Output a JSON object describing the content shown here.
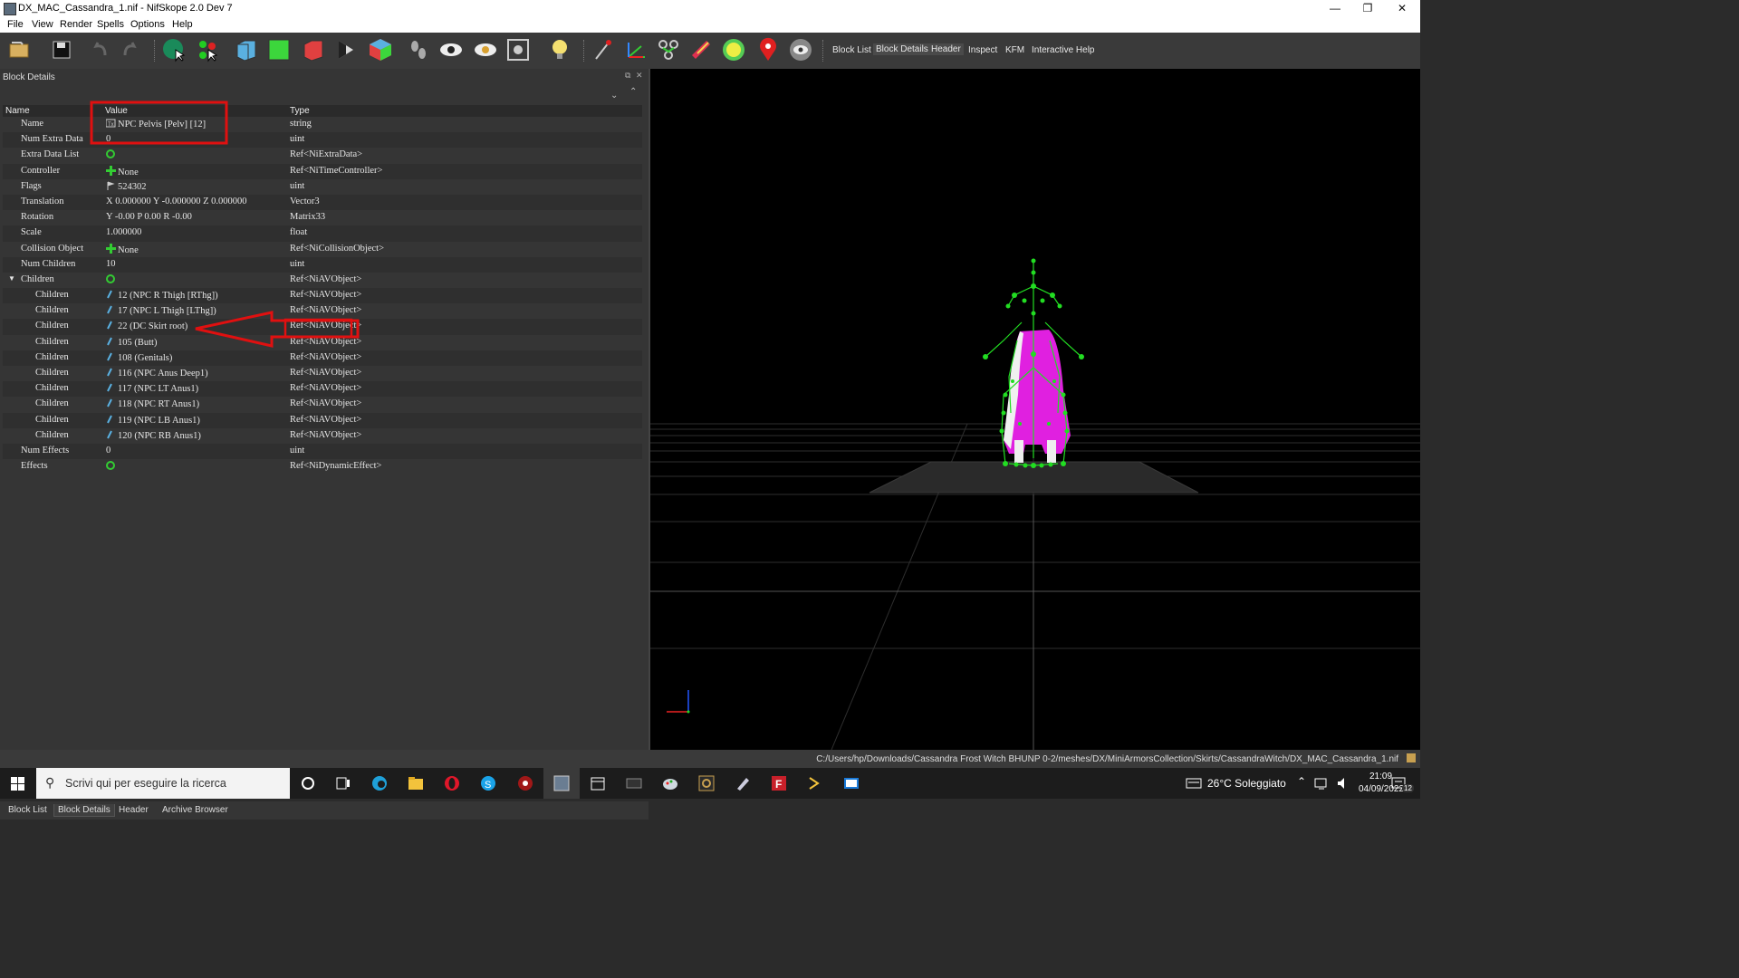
{
  "window": {
    "title": "DX_MAC_Cassandra_1.nif - NifSkope 2.0 Dev 7"
  },
  "menu": [
    "File",
    "View",
    "Render",
    "Spells",
    "Options",
    "Help"
  ],
  "toolbar_tabs": [
    "Block List",
    "Block Details",
    "Header",
    "Inspect",
    "KFM",
    "Interactive Help"
  ],
  "dock": {
    "title": "Block Details"
  },
  "table": {
    "headers": {
      "name": "Name",
      "value": "Value",
      "type": "Type"
    },
    "rows": [
      {
        "name": "Name",
        "value": "NPC Pelvis [Pelv] [12]",
        "type": "string",
        "icon": "text-icon"
      },
      {
        "name": "Num Extra Data",
        "value": "0",
        "type": "uint"
      },
      {
        "name": "Extra Data List",
        "value": "",
        "type": "Ref<NiExtraData>",
        "icon": "array-icon"
      },
      {
        "name": "Controller",
        "value": "None",
        "type": "Ref<NiTimeController>",
        "icon": "plus-icon"
      },
      {
        "name": "Flags",
        "value": "524302",
        "type": "uint",
        "icon": "flag-icon"
      },
      {
        "name": "Translation",
        "value": "X 0.000000 Y -0.000000 Z 0.000000",
        "type": "Vector3"
      },
      {
        "name": "Rotation",
        "value": "Y -0.00 P 0.00 R -0.00",
        "type": "Matrix33"
      },
      {
        "name": "Scale",
        "value": "1.000000",
        "type": "float"
      },
      {
        "name": "Collision Object",
        "value": "None",
        "type": "Ref<NiCollisionObject>",
        "icon": "plus-icon"
      },
      {
        "name": "Num Children",
        "value": "10",
        "type": "uint"
      },
      {
        "name": "Children",
        "value": "",
        "type": "Ref<NiAVObject>",
        "icon": "array-icon",
        "expanded": true
      },
      {
        "name": "Children",
        "value": "12 (NPC R Thigh [RThg])",
        "type": "Ref<NiAVObject>",
        "icon": "link-icon",
        "child": true
      },
      {
        "name": "Children",
        "value": "17 (NPC L Thigh [LThg])",
        "type": "Ref<NiAVObject>",
        "icon": "link-icon",
        "child": true
      },
      {
        "name": "Children",
        "value": "22 (DC Skirt root)",
        "type": "Ref<NiAVObject>",
        "icon": "link-icon",
        "child": true
      },
      {
        "name": "Children",
        "value": "105 (Butt)",
        "type": "Ref<NiAVObject>",
        "icon": "link-icon",
        "child": true
      },
      {
        "name": "Children",
        "value": "108 (Genitals)",
        "type": "Ref<NiAVObject>",
        "icon": "link-icon",
        "child": true
      },
      {
        "name": "Children",
        "value": "116 (NPC Anus Deep1)",
        "type": "Ref<NiAVObject>",
        "icon": "link-icon",
        "child": true
      },
      {
        "name": "Children",
        "value": "117 (NPC LT Anus1)",
        "type": "Ref<NiAVObject>",
        "icon": "link-icon",
        "child": true
      },
      {
        "name": "Children",
        "value": "118 (NPC RT Anus1)",
        "type": "Ref<NiAVObject>",
        "icon": "link-icon",
        "child": true
      },
      {
        "name": "Children",
        "value": "119 (NPC LB Anus1)",
        "type": "Ref<NiAVObject>",
        "icon": "link-icon",
        "child": true
      },
      {
        "name": "Children",
        "value": "120 (NPC RB Anus1)",
        "type": "Ref<NiAVObject>",
        "icon": "link-icon",
        "child": true
      },
      {
        "name": "Num Effects",
        "value": "0",
        "type": "uint"
      },
      {
        "name": "Effects",
        "value": "",
        "type": "Ref<NiDynamicEffect>",
        "icon": "array-icon"
      }
    ]
  },
  "bottom_tabs": [
    "Block List",
    "Block Details",
    "Header",
    "Archive Browser"
  ],
  "status": {
    "path": "C:/Users/hp/Downloads/Cassandra Frost Witch BHUNP 0-2/meshes/DX/MiniArmorsCollection/Skirts/CassandraWitch/DX_MAC_Cassandra_1.nif"
  },
  "taskbar": {
    "search_placeholder": "Scrivi qui per eseguire la ricerca",
    "weather": "26°C Soleggiato",
    "time": "21:09",
    "date": "04/09/2022",
    "notifications": "12"
  },
  "colors": {
    "accent_green": "#22dd22",
    "mesh_magenta": "#e020e0",
    "annotation_red": "#e01010",
    "viewport_bg": "#000000"
  }
}
